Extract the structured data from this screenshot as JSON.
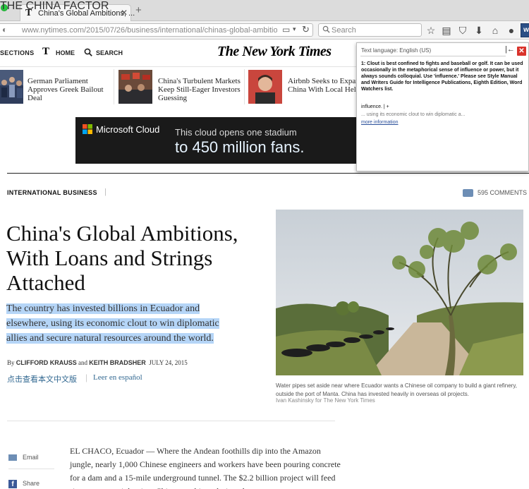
{
  "browser": {
    "tab_title": "China's Global Ambitions, ...",
    "tab_close": "✕",
    "new_tab": "+",
    "url": "www.nytimes.com/2015/07/26/business/international/chinas-global-ambitions-with-loans-",
    "search_placeholder": "Search",
    "extension_label": "w"
  },
  "header": {
    "sections": "SECTIONS",
    "t_logo": "T",
    "home": "HOME",
    "search": "SEARCH",
    "masthead": "The New York Times"
  },
  "related": [
    {
      "title": "German Parliament Approves Greek Bailout Deal"
    },
    {
      "title": "China's Turbulent Markets Keep Still-Eager Investors Guessing"
    },
    {
      "title": "Airbnb Seeks to Expand in China With Local Help"
    }
  ],
  "ad": {
    "brand": "Microsoft Cloud",
    "line1": "This cloud opens one stadium",
    "line2": "to 450 million fans."
  },
  "article": {
    "kicker": "INTERNATIONAL BUSINESS",
    "kicker_sep": "|",
    "subkicker": "THE CHINA FACTOR",
    "comments": "595 COMMENTS",
    "headline": "China's Global Ambitions, With Loans and Strings Attached",
    "summary": "The country has invested billions in Ecuador and elsewhere, using its economic clout to win diplomatic allies and secure natural resources around the world.",
    "byline_prefix": "By",
    "author1": "CLIFFORD KRAUSS",
    "byline_and": "and",
    "author2": "KEITH BRADSHER",
    "date": "JULY 24, 2015",
    "lang_chinese": "点击查看本文中文版",
    "lang_sep": "|",
    "lang_spanish": "Leer en español",
    "caption": "Water pipes set aside near where Ecuador wants a Chinese oil company to build a giant refinery, outside the port of Manta. China has invested heavily in overseas oil projects.",
    "credit": "Ivan Kashinsky for The New York Times",
    "body": "EL CHACO, Ecuador — Where the Andean foothills dip into the Amazon jungle, nearly 1,000 Chinese engineers and workers have been pouring concrete for a dam and a 15-mile underground tunnel. The $2.2 billion project will feed river water to eight giant Chinese turbines designed to"
  },
  "share": {
    "email": "Email",
    "facebook_icon": "f",
    "share": "Share"
  },
  "popup": {
    "language": "Text language: English (US)",
    "back": "|←",
    "close": "✕",
    "definition": "1: Clout is best confined to fights and baseball or golf. It can be used occasionally in the metaphorical sense of influence or power, but it always sounds colloquial. Use 'influence.' Please see Style Manual and Writers Guide for Intelligence Publications, Eighth Edition, Word Watchers list.",
    "suggestion": "influence. | +",
    "context": "... using its economic clout to win diplomatic a...",
    "more": "more information"
  },
  "icons": {
    "bookmark_star": "star-icon",
    "reading_list": "reading-list-icon",
    "pocket": "pocket-icon",
    "download": "download-icon",
    "home": "home-icon",
    "chat": "chat-icon"
  },
  "colors": {
    "link_blue": "#326891",
    "highlight": "#b5d5f7",
    "close_red": "#d9332c",
    "comment_blue": "#6d8eb5"
  }
}
